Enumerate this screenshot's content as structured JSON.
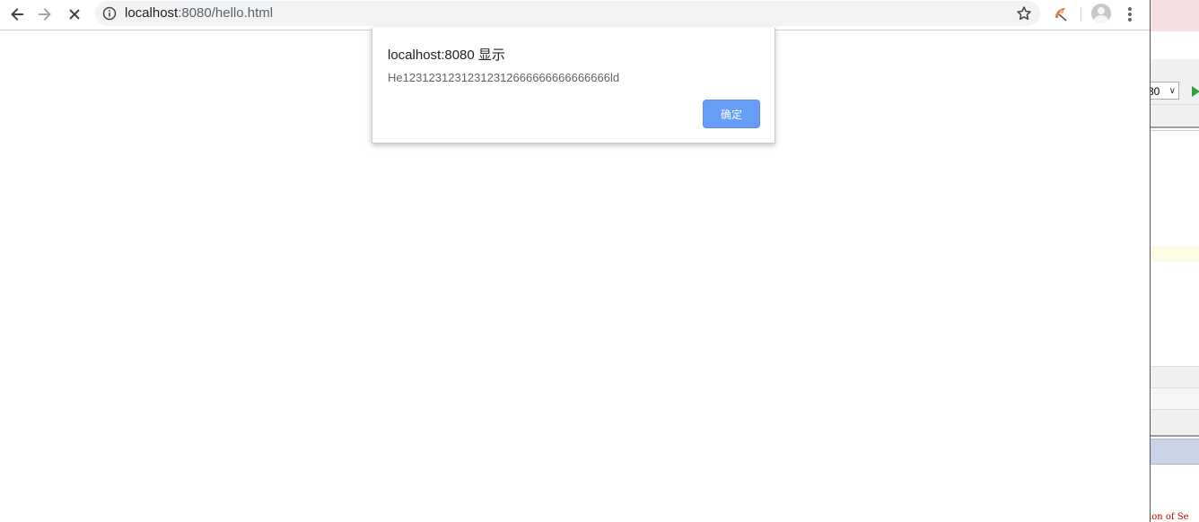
{
  "browser": {
    "url_host": "localhost",
    "url_rest": ":8080/hello.html",
    "icons": {
      "back": "arrow-left-icon",
      "forward": "arrow-right-icon",
      "stop": "close-icon",
      "info": "info-icon",
      "bookmark": "star-icon",
      "extension": "extension-icon",
      "profile": "avatar-icon",
      "menu": "more-vert-icon"
    }
  },
  "dialog": {
    "title": "localhost:8080 显示",
    "message": "He12312312312312312666666666666666ld",
    "ok_label": "确定",
    "accent": "#669df6"
  },
  "ide": {
    "combo_value": "30",
    "bottom_text": "ion of Se",
    "run_color": "#2fa23c"
  }
}
